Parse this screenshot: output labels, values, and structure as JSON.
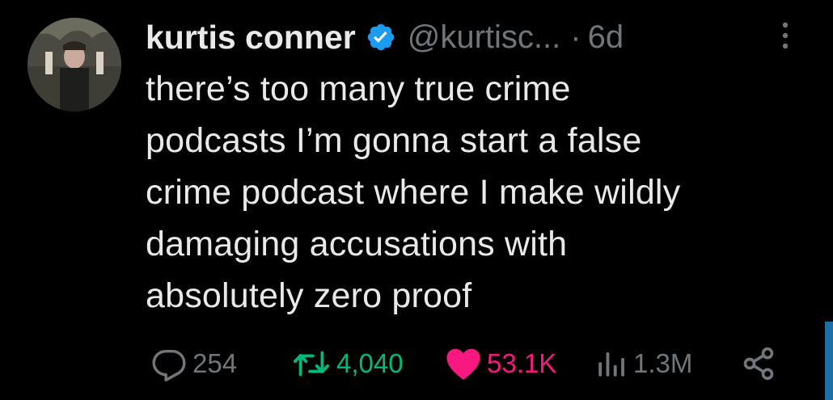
{
  "author": {
    "display_name": "kurtis conner",
    "handle": "@kurtisc...",
    "separator": "·",
    "time_ago": "6d",
    "verified_icon": "verified-badge-icon",
    "verified_color": "#1d9bf0"
  },
  "tweet": {
    "lines": [
      "there’s too many true crime",
      "podcasts I’m gonna start a false",
      "crime podcast where I make wildly",
      "damaging accusations with",
      "absolutely zero proof"
    ]
  },
  "actions": {
    "reply_count": "254",
    "retweet_count": "4,040",
    "like_count": "53.1K",
    "view_count": "1.3M",
    "retweeted": true,
    "liked": true,
    "colors": {
      "muted": "#71767b",
      "retweet": "#00ba7c",
      "like": "#f91880"
    }
  },
  "icons": [
    "more-icon",
    "reply-icon",
    "retweet-icon",
    "heart-icon",
    "views-icon",
    "share-icon"
  ]
}
